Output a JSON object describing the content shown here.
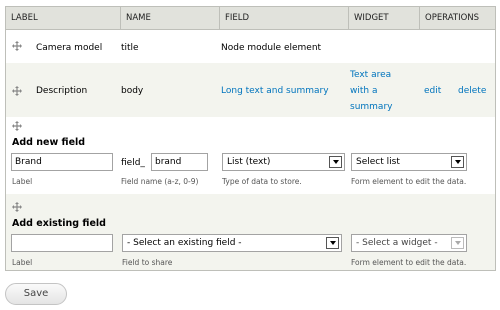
{
  "header": {
    "label": "LABEL",
    "name": "NAME",
    "field": "FIELD",
    "widget": "WIDGET",
    "operations": "OPERATIONS"
  },
  "rows": [
    {
      "label": "Camera model",
      "name": "title",
      "field": "Node module element"
    },
    {
      "label": "Description",
      "name": "body",
      "field": "Long text and summary",
      "widget_line1": "Text area",
      "widget_line2": "with a",
      "widget_line3": "summary",
      "edit": "edit",
      "delete": "delete"
    }
  ],
  "add_new": {
    "title": "Add new field",
    "label_value": "Brand",
    "label_desc": "Label",
    "name_prefix": "field_",
    "name_value": "brand",
    "name_desc": "Field name (a-z, 0-9)",
    "type_value": "List (text)",
    "type_desc": "Type of data to store.",
    "widget_value": "Select list",
    "widget_desc": "Form element to edit the data."
  },
  "add_existing": {
    "title": "Add existing field",
    "label_value": "",
    "label_desc": "Label",
    "field_value": "- Select an existing field -",
    "field_desc": "Field to share",
    "widget_value": "- Select a widget -",
    "widget_desc": "Form element to edit the data."
  },
  "save_label": "Save",
  "colors": {
    "header_bg": "#e1e2dc",
    "row_alt_bg": "#f3f4ee",
    "link": "#0074bd",
    "border": "#bebfb9"
  }
}
